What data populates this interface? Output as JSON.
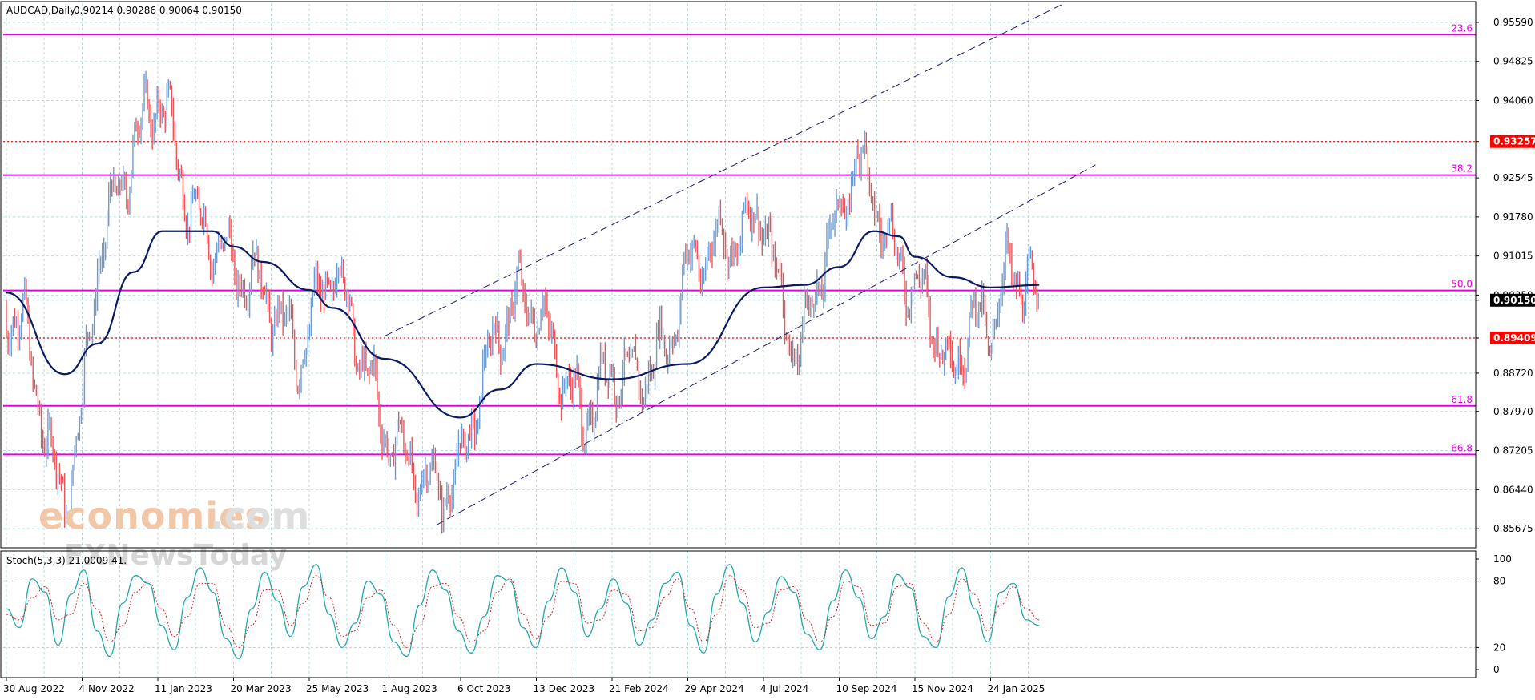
{
  "header": {
    "symbol": "AUDCAD,Daily",
    "ohlc": "0.90214 0.90286 0.90064 0.90150"
  },
  "watermark": {
    "brand_part1": "economies",
    "brand_part2": ".com",
    "brand_line2": "FXNewsToday"
  },
  "chart_data": [
    {
      "type": "candlestick",
      "title": "AUDCAD,Daily",
      "ylim": [
        0.853,
        0.9595
      ],
      "yticks": [
        "0.95590",
        "0.94825",
        "0.94060",
        "0.93257",
        "0.92545",
        "0.91780",
        "0.91015",
        "0.90250",
        "0.90150",
        "0.89409",
        "0.88720",
        "0.87970",
        "0.87205",
        "0.86440",
        "0.85675"
      ],
      "xtick_labels": [
        "30 Aug 2022",
        "4 Nov 2022",
        "11 Jan 2023",
        "20 Mar 2023",
        "25 May 2023",
        "1 Aug 2023",
        "6 Oct 2023",
        "13 Dec 2023",
        "21 Feb 2024",
        "29 Apr 2024",
        "4 Jul 2024",
        "10 Sep 2024",
        "15 Nov 2024",
        "24 Jan 2025"
      ],
      "close_path": [
        [
          "30 Aug 2022",
          0.9
        ],
        [
          "15 Sep 2022",
          0.896
        ],
        [
          "10 Oct 2022",
          0.868
        ],
        [
          "20 Oct 2022",
          0.862
        ],
        [
          "4 Nov 2022",
          0.88
        ],
        [
          "18 Nov 2022",
          0.91
        ],
        [
          "10 Dec 2022",
          0.925
        ],
        [
          "1 Jan 2023",
          0.938
        ],
        [
          "11 Jan 2023",
          0.942
        ],
        [
          "25 Jan 2023",
          0.933
        ],
        [
          "10 Feb 2023",
          0.918
        ],
        [
          "28 Feb 2023",
          0.914
        ],
        [
          "20 Mar 2023",
          0.908
        ],
        [
          "10 Apr 2023",
          0.905
        ],
        [
          "25 Apr 2023",
          0.9
        ],
        [
          "15 May 2023",
          0.89
        ],
        [
          "25 May 2023",
          0.896
        ],
        [
          "15 Jun 2023",
          0.909
        ],
        [
          "1 Jul 2023",
          0.898
        ],
        [
          "1 Aug 2023",
          0.876
        ],
        [
          "20 Aug 2023",
          0.87
        ],
        [
          "15 Sep 2023",
          0.864
        ],
        [
          "6 Oct 2023",
          0.868
        ],
        [
          "20 Oct 2023",
          0.882
        ],
        [
          "10 Nov 2023",
          0.896
        ],
        [
          "25 Nov 2023",
          0.902
        ],
        [
          "13 Dec 2023",
          0.9
        ],
        [
          "5 Jan 2024",
          0.888
        ],
        [
          "25 Jan 2024",
          0.878
        ],
        [
          "21 Feb 2024",
          0.888
        ],
        [
          "15 Mar 2024",
          0.886
        ],
        [
          "10 Apr 2024",
          0.892
        ],
        [
          "29 Apr 2024",
          0.908
        ],
        [
          "20 May 2024",
          0.912
        ],
        [
          "15 Jun 2024",
          0.914
        ],
        [
          "4 Jul 2024",
          0.92
        ],
        [
          "15 Jul 2024",
          0.905
        ],
        [
          "5 Aug 2024",
          0.89
        ],
        [
          "20 Aug 2024",
          0.905
        ],
        [
          "10 Sep 2024",
          0.918
        ],
        [
          "25 Sep 2024",
          0.93
        ],
        [
          "10 Oct 2024",
          0.922
        ],
        [
          "1 Nov 2024",
          0.908
        ],
        [
          "15 Nov 2024",
          0.905
        ],
        [
          "5 Dec 2024",
          0.896
        ],
        [
          "20 Dec 2024",
          0.886
        ],
        [
          "5 Jan 2025",
          0.898
        ],
        [
          "24 Jan 2025",
          0.896
        ],
        [
          "10 Feb 2025",
          0.908
        ],
        [
          "28 Feb 2025",
          0.904
        ],
        [
          "10 Mar 2025",
          0.9015
        ]
      ],
      "moving_average": [
        [
          "30 Aug 2022",
          0.903
        ],
        [
          "20 Oct 2022",
          0.887
        ],
        [
          "18 Nov 2022",
          0.893
        ],
        [
          "20 Dec 2022",
          0.907
        ],
        [
          "15 Jan 2023",
          0.915
        ],
        [
          "1 Mar 2023",
          0.915
        ],
        [
          "20 Mar 2023",
          0.912
        ],
        [
          "15 Apr 2023",
          0.909
        ],
        [
          "25 May 2023",
          0.9035
        ],
        [
          "15 Jun 2023",
          0.9
        ],
        [
          "1 Aug 2023",
          0.89
        ],
        [
          "6 Oct 2023",
          0.8785
        ],
        [
          "10 Nov 2023",
          0.884
        ],
        [
          "13 Dec 2023",
          0.889
        ],
        [
          "21 Feb 2024",
          0.886
        ],
        [
          "29 Apr 2024",
          0.889
        ],
        [
          "4 Jul 2024",
          0.904
        ],
        [
          "10 Aug 2024",
          0.9045
        ],
        [
          "10 Sep 2024",
          0.908
        ],
        [
          "10 Oct 2024",
          0.915
        ],
        [
          "1 Nov 2024",
          0.914
        ],
        [
          "15 Nov 2024",
          0.91
        ],
        [
          "20 Dec 2024",
          0.906
        ],
        [
          "24 Jan 2025",
          0.904
        ],
        [
          "10 Mar 2025",
          0.9045
        ]
      ],
      "channel_upper": [
        [
          "1 Aug 2023",
          0.8945
        ],
        [
          "1 Apr 2025",
          0.9595
        ]
      ],
      "channel_lower": [
        [
          "15 Sep 2023",
          0.8575
        ],
        [
          "1 May 2025",
          0.928
        ]
      ],
      "fib_levels": [
        {
          "label": "23.6",
          "value": 0.9535
        },
        {
          "label": "38.2",
          "value": 0.926
        },
        {
          "label": "50.0",
          "value": 0.9034
        },
        {
          "label": "61.8",
          "value": 0.8808
        },
        {
          "label": "66.8",
          "value": 0.8713
        }
      ],
      "horizontal_levels": [
        {
          "value": 0.93257,
          "color": "#ff0000",
          "style": "dotted"
        },
        {
          "value": 0.89409,
          "color": "#ff0000",
          "style": "dotted"
        }
      ],
      "price_badges": [
        {
          "label": "0.93257",
          "value": 0.93257,
          "color": "#ff0000"
        },
        {
          "label": "0.90150",
          "value": 0.9015,
          "color": "#000000"
        },
        {
          "label": "0.89409",
          "value": 0.89409,
          "color": "#ff0000"
        }
      ],
      "colors": {
        "bull": "#6e9bd0",
        "bear": "#e8565a",
        "ma": "#0b1b63",
        "fib": "#e600e6",
        "channel": "#1c1c6e",
        "grid": "#b7dede"
      },
      "grid": true
    },
    {
      "type": "line",
      "title": "Stoch(5,3,3) 21.0009 41.",
      "ylim": [
        0,
        100
      ],
      "yticks": [
        "100",
        "80",
        "20",
        "0"
      ],
      "levels": [
        20,
        80
      ],
      "series": [
        {
          "values": [
            55,
            38,
            82,
            70,
            22,
            68,
            90,
            35,
            12,
            60,
            85,
            78,
            40,
            18,
            65,
            92,
            70,
            28,
            10,
            55,
            88,
            62,
            30,
            75,
            95,
            50,
            20,
            42,
            80,
            68,
            25,
            12,
            58,
            90,
            72,
            35,
            15,
            48,
            85,
            80,
            38,
            20,
            62,
            92,
            70,
            30,
            55,
            82,
            60,
            22,
            45,
            78,
            88,
            40,
            15,
            68,
            95,
            60,
            25,
            52,
            84,
            70,
            32,
            18,
            62,
            90,
            65,
            28,
            48,
            86,
            74,
            30,
            20,
            66,
            92,
            55,
            25,
            70,
            78,
            45,
            40
          ]
        },
        {
          "values": [
            50,
            45,
            65,
            75,
            45,
            50,
            78,
            55,
            25,
            40,
            70,
            80,
            55,
            30,
            48,
            78,
            78,
            40,
            20,
            40,
            72,
            72,
            40,
            60,
            85,
            65,
            30,
            35,
            65,
            72,
            40,
            20,
            40,
            75,
            78,
            48,
            25,
            35,
            70,
            82,
            50,
            28,
            48,
            80,
            78,
            42,
            45,
            72,
            68,
            35,
            38,
            65,
            82,
            55,
            25,
            50,
            85,
            72,
            38,
            42,
            72,
            75,
            45,
            25,
            48,
            80,
            75,
            40,
            42,
            75,
            78,
            42,
            25,
            50,
            82,
            68,
            35,
            58,
            75,
            55,
            45
          ]
        }
      ],
      "colors": {
        "main": "#20a8a8",
        "signal": "#cc2222",
        "level": "#c8c8c8"
      },
      "grid": true
    }
  ]
}
